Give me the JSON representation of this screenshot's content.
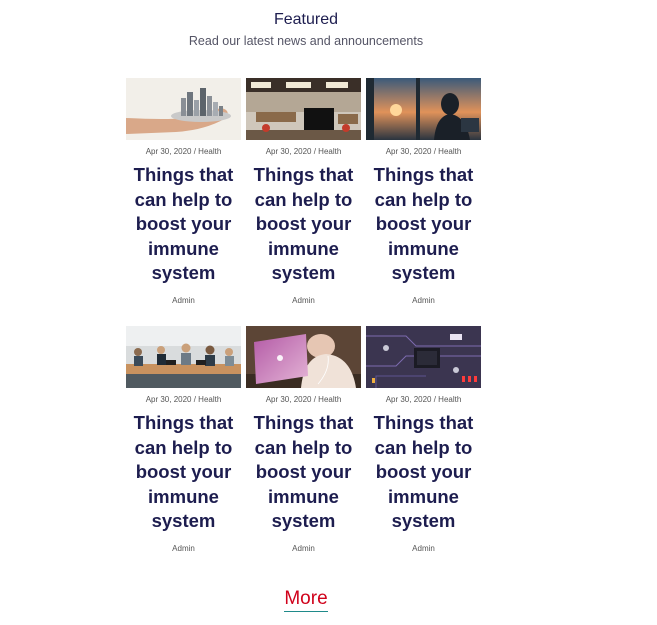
{
  "section": {
    "title": "Featured",
    "subtitle": "Read our latest news and announcements"
  },
  "posts": [
    {
      "image": "city-in-hand-image",
      "meta": "Apr 30, 2020 / Health",
      "title": "Things that can help to boost your immune system",
      "author": "Admin"
    },
    {
      "image": "office-interior-image",
      "meta": "Apr 30, 2020 / Health",
      "title": "Things that can help to boost your immune system",
      "author": "Admin"
    },
    {
      "image": "window-sunset-image",
      "meta": "Apr 30, 2020 / Health",
      "title": "Things that can help to boost your immune system",
      "author": "Admin"
    },
    {
      "image": "team-meeting-image",
      "meta": "Apr 30, 2020 / Health",
      "title": "Things that can help to boost your immune system",
      "author": "Admin"
    },
    {
      "image": "laptop-woman-image",
      "meta": "Apr 30, 2020 / Health",
      "title": "Things that can help to boost your immune system",
      "author": "Admin"
    },
    {
      "image": "circuit-board-image",
      "meta": "Apr 30, 2020 / Health",
      "title": "Things that can help to boost your immune system",
      "author": "Admin"
    }
  ],
  "more_label": "More",
  "colors": {
    "heading": "#1d1d4f",
    "more_link": "#d0021b",
    "more_underline": "#1f8a8a"
  }
}
